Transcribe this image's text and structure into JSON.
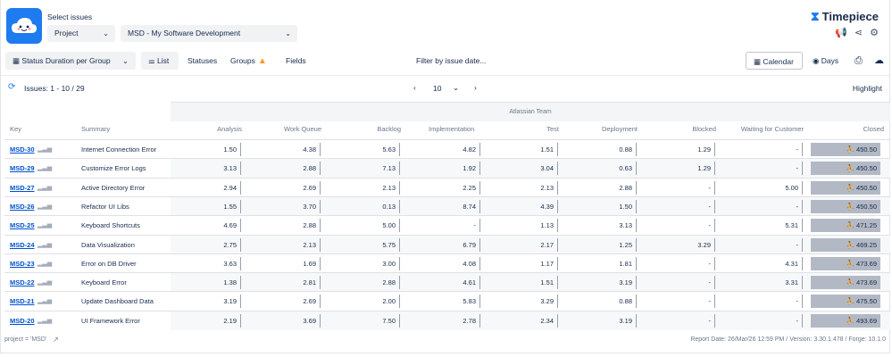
{
  "header": {
    "select_title": "Select issues",
    "project_select": "Project",
    "project_value": "MSD - My Software Development",
    "brand": "Timepiece"
  },
  "toolbar": {
    "report_type": "Status Duration per Group",
    "list": "List",
    "statuses": "Statuses",
    "groups": "Groups",
    "fields": "Fields",
    "filter": "Filter by issue date...",
    "calendar": "Calendar",
    "days": "Days"
  },
  "issuebar": {
    "issues": "Issues: 1 - 10 / 29",
    "page_size": "10",
    "highlight": "Highlight"
  },
  "table": {
    "team_header": "Atlassian Team",
    "columns": [
      "Key",
      "Summary",
      "Analysis",
      "Work Queue",
      "Backlog",
      "Implementation",
      "Test",
      "Deployment",
      "Blocked",
      "Waiting for Customer",
      "Closed"
    ],
    "rows": [
      {
        "key": "MSD-30",
        "summary": "Internet Connection Error",
        "values": [
          "1.50",
          "4.38",
          "5.63",
          "4.82",
          "1.51",
          "0.88",
          "1.29",
          "-",
          "⛹ 450.50"
        ]
      },
      {
        "key": "MSD-29",
        "summary": "Customize Error Logs",
        "values": [
          "3.13",
          "2.88",
          "7.13",
          "1.92",
          "3.04",
          "0.63",
          "1.29",
          "-",
          "⛹ 450.50"
        ]
      },
      {
        "key": "MSD-27",
        "summary": "Active Directory Error",
        "values": [
          "2.94",
          "2.69",
          "2.13",
          "2.25",
          "2.13",
          "2.88",
          "-",
          "5.00",
          "⛹ 450.50"
        ]
      },
      {
        "key": "MSD-26",
        "summary": "Refactor UI Libs",
        "values": [
          "1.55",
          "3.70",
          "0.13",
          "8.74",
          "4.39",
          "1.50",
          "-",
          "-",
          "⛹ 450.50"
        ]
      },
      {
        "key": "MSD-25",
        "summary": "Keyboard Shortcuts",
        "values": [
          "4.69",
          "2.88",
          "5.00",
          "-",
          "1.13",
          "3.13",
          "-",
          "5.31",
          "⛹ 471.25"
        ]
      },
      {
        "key": "MSD-24",
        "summary": "Data Visualization",
        "values": [
          "2.75",
          "2.13",
          "5.75",
          "6.79",
          "2.17",
          "1.25",
          "3.29",
          "-",
          "⛹ 469.25"
        ]
      },
      {
        "key": "MSD-23",
        "summary": "Error on DB Driver",
        "values": [
          "3.63",
          "1.69",
          "3.00",
          "4.08",
          "1.17",
          "1.81",
          "-",
          "4.31",
          "⛹ 473.69"
        ]
      },
      {
        "key": "MSD-22",
        "summary": "Keyboard Error",
        "values": [
          "1.38",
          "2.81",
          "2.88",
          "4.61",
          "1.51",
          "3.19",
          "-",
          "3.31",
          "⛹ 473.69"
        ]
      },
      {
        "key": "MSD-21",
        "summary": "Update Dashboard Data",
        "values": [
          "3.19",
          "2.69",
          "2.00",
          "5.83",
          "3.29",
          "0.88",
          "-",
          "-",
          "⛹ 475.50"
        ]
      },
      {
        "key": "MSD-20",
        "summary": "UI Framework Error",
        "values": [
          "2.19",
          "3.69",
          "7.50",
          "2.78",
          "2.34",
          "3.19",
          "-",
          "-",
          "⛹ 493.69"
        ]
      }
    ]
  },
  "footer": {
    "query": "project = 'MSD'",
    "report_info": "Report Date: 26/Mar/26 12:59 PM / Version: 3.30.1.478 / Forge: 10.1.0"
  }
}
